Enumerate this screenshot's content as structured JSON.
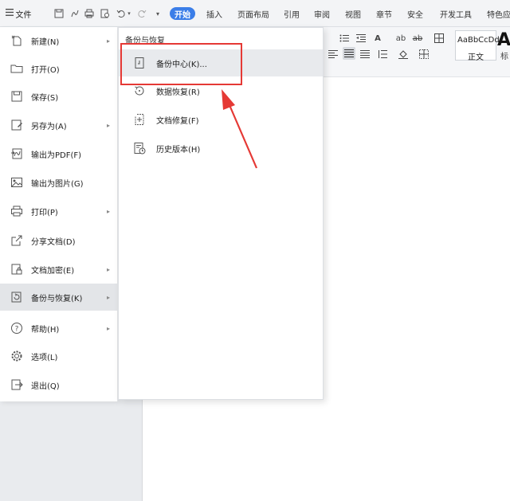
{
  "toolbar": {
    "file_label": "文件",
    "tabs": [
      {
        "label": "开始",
        "active": true
      },
      {
        "label": "插入",
        "active": false
      },
      {
        "label": "页面布局",
        "active": false
      },
      {
        "label": "引用",
        "active": false
      },
      {
        "label": "审阅",
        "active": false
      },
      {
        "label": "视图",
        "active": false
      },
      {
        "label": "章节",
        "active": false
      },
      {
        "label": "安全",
        "active": false
      },
      {
        "label": "开发工具",
        "active": false
      },
      {
        "label": "特色应",
        "active": false
      }
    ]
  },
  "styles": {
    "sample": "AaBbCcDd",
    "normal_label": "正文",
    "big_sample": "Aa",
    "big_sub": "标"
  },
  "file_menu": {
    "items": [
      {
        "label": "新建(N)",
        "icon": "new-doc-icon",
        "has_submenu": true
      },
      {
        "label": "打开(O)",
        "icon": "folder-icon",
        "has_submenu": false
      },
      {
        "label": "保存(S)",
        "icon": "save-icon",
        "has_submenu": false
      },
      {
        "label": "另存为(A)",
        "icon": "save-as-icon",
        "has_submenu": true
      },
      {
        "label": "输出为PDF(F)",
        "icon": "pdf-icon",
        "has_submenu": false
      },
      {
        "label": "输出为图片(G)",
        "icon": "image-icon",
        "has_submenu": false
      },
      {
        "label": "打印(P)",
        "icon": "print-icon",
        "has_submenu": true
      },
      {
        "label": "分享文档(D)",
        "icon": "share-icon",
        "has_submenu": false
      },
      {
        "label": "文档加密(E)",
        "icon": "lock-doc-icon",
        "has_submenu": true
      },
      {
        "label": "备份与恢复(K)",
        "icon": "backup-icon",
        "has_submenu": true,
        "active": true
      },
      {
        "label": "帮助(H)",
        "icon": "help-icon",
        "has_submenu": true
      },
      {
        "label": "选项(L)",
        "icon": "gear-icon",
        "has_submenu": false
      },
      {
        "label": "退出(Q)",
        "icon": "exit-icon",
        "has_submenu": false
      }
    ]
  },
  "submenu": {
    "title": "备份与恢复",
    "items": [
      {
        "label": "备份中心(K)...",
        "icon": "backup-center-icon",
        "highlighted": true
      },
      {
        "label": "数据恢复(R)",
        "icon": "data-recovery-icon"
      },
      {
        "label": "文档修复(F)",
        "icon": "doc-repair-icon"
      },
      {
        "label": "历史版本(H)",
        "icon": "history-version-icon"
      }
    ]
  },
  "colors": {
    "accent": "#3b7ee8",
    "annotation": "#e53935"
  }
}
